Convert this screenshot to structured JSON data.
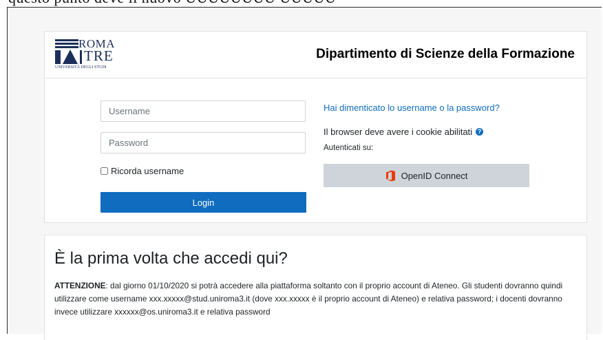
{
  "top_strip_text": "questo punto deve il nuovo UUUUUUUU UUUUU",
  "header": {
    "logo": {
      "line1": "ROMA",
      "line2": "TRE",
      "line3": "UNIVERSITÀ DEGLI STUDI"
    },
    "department": "Dipartimento di Scienze della Formazione"
  },
  "login_form": {
    "username_placeholder": "Username",
    "password_placeholder": "Password",
    "remember_label": "Ricorda username",
    "login_button": "Login"
  },
  "login_help": {
    "forgot_link": "Hai dimenticato lo username o la password?",
    "cookies_text": "Il browser deve avere i cookie abilitati",
    "auth_label": "Autenticati su:",
    "openid_button": "OpenID Connect"
  },
  "first_time": {
    "title": "È la prima volta che accedi qui?",
    "notice_label": "ATTENZIONE",
    "notice_text": ": dal giorno 01/10/2020 si potrà accedere alla piattaforma soltanto con il proprio account di Ateneo. Gli studenti dovranno quindi utilizzare come username xxx.xxxxx@stud.uniroma3.it (dove xxx.xxxxx è il proprio account di Ateneo) e relativa password; i docenti dovranno invece utilizzare xxxxxx@os.uniroma3.it e relativa password"
  },
  "colors": {
    "primary": "#0f6cbf",
    "secondary_button": "#ced4da",
    "page_background": "#f6f6f6",
    "office_icon": "#eb3c00"
  },
  "icons": {
    "help": "question-circle-icon",
    "openid": "office-icon"
  }
}
